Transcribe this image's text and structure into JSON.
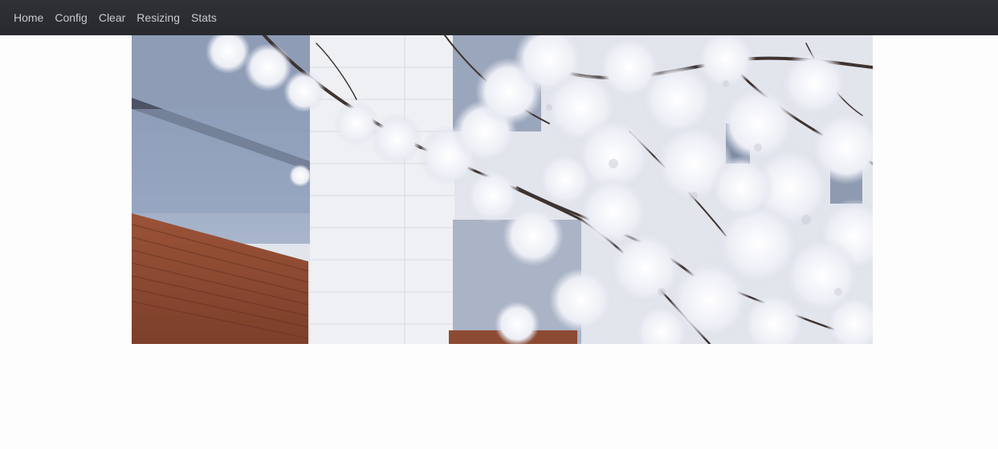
{
  "nav": {
    "items": [
      {
        "label": "Home",
        "name": "nav-home"
      },
      {
        "label": "Config",
        "name": "nav-config"
      },
      {
        "label": "Clear",
        "name": "nav-clear"
      },
      {
        "label": "Resizing",
        "name": "nav-resizing"
      },
      {
        "label": "Stats",
        "name": "nav-stats"
      }
    ]
  },
  "colors": {
    "navbar_bg": "#2b2d31",
    "nav_text": "#c9cbcf",
    "page_bg": "#fdfdfd"
  },
  "main_image": {
    "subject": "cherry-blossom-photo"
  }
}
